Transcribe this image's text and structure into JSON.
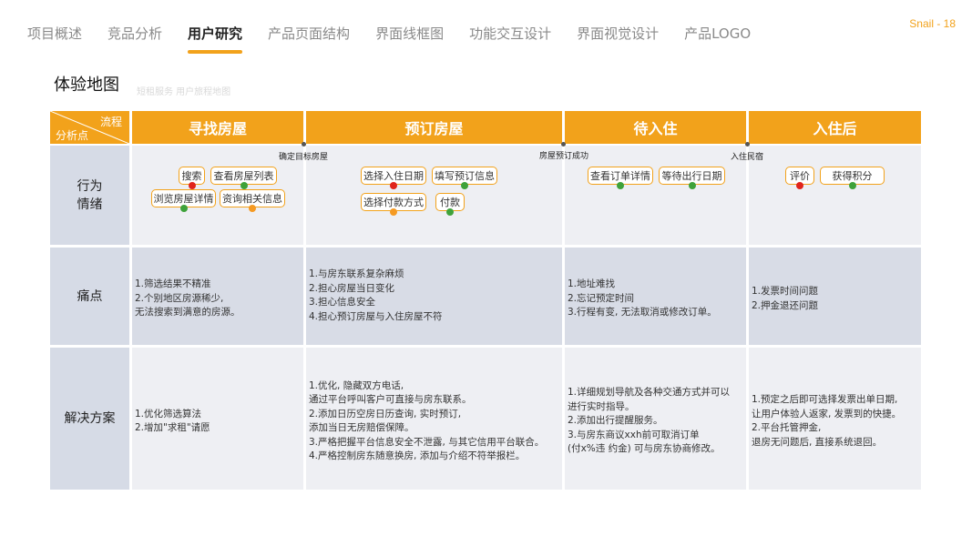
{
  "nav": {
    "items": [
      "项目概述",
      "竞品分析",
      "用户研究",
      "产品页面结构",
      "界面线框图",
      "功能交互设计",
      "界面视觉设计",
      "产品LOGO"
    ],
    "active_index": 2
  },
  "page_number": "Snail - 18",
  "section": {
    "title": "体验地图",
    "subtitle": "短租服务  用户旅程地图"
  },
  "table": {
    "corner": {
      "top": "流程",
      "bottom": "分析点"
    },
    "stages": [
      "寻找房屋",
      "预订房屋",
      "待入住",
      "入住后"
    ],
    "markers": [
      "确定目标房屋",
      "房屋预订成功",
      "入住民宿"
    ],
    "rows": {
      "behavior": {
        "label_lines": [
          "行为",
          "情绪"
        ],
        "tags": [
          [
            {
              "text": "搜索",
              "mood": "red"
            },
            {
              "text": "查看房屋列表",
              "mood": "green"
            },
            {
              "text": "浏览房屋详情",
              "mood": "green"
            },
            {
              "text": "资询相关信息",
              "mood": "orange"
            }
          ],
          [
            {
              "text": "选择入住日期",
              "mood": "red"
            },
            {
              "text": "填写预订信息",
              "mood": "green"
            },
            {
              "text": "选择付款方式",
              "mood": "orange"
            },
            {
              "text": "付款",
              "mood": "green"
            }
          ],
          [
            {
              "text": "查看订单详情",
              "mood": "green"
            },
            {
              "text": "等待出行日期",
              "mood": "green"
            }
          ],
          [
            {
              "text": "评价",
              "mood": "red"
            },
            {
              "text": "获得积分",
              "mood": "green"
            }
          ]
        ]
      },
      "pain": {
        "label": "痛点",
        "cells": [
          [
            "1.筛选结果不精准",
            "2.个别地区房源稀少,",
            "   无法搜索到满意的房源。"
          ],
          [
            "1.与房东联系复杂麻烦",
            "2.担心房屋当日变化",
            "3.担心信息安全",
            "4.担心预订房屋与入住房屋不符"
          ],
          [
            "1.地址难找",
            "2.忘记预定时间",
            "3.行程有变, 无法取消或修改订单。"
          ],
          [
            "1.发票时间问题",
            "2.押金退还问题"
          ]
        ]
      },
      "solution": {
        "label": "解决方案",
        "cells": [
          [
            "1.优化筛选算法",
            "2.增加\"求租\"请愿"
          ],
          [
            "1.优化, 隐藏双方电话,",
            "   通过平台呼叫客户可直接与房东联系。",
            "2.添加日历空房日历查询, 实时预订,",
            "   添加当日无房赔偿保障。",
            "3.严格把握平台信息安全不泄露, 与其它信用平台联合。",
            "4.严格控制房东随意换房, 添加与介绍不符举报栏。"
          ],
          [
            "1.详细规划导航及各种交通方式并可以",
            "进行实时指导。",
            "2.添加出行提醒服务。",
            "3.与房东商议xxh前可取消订单",
            "  (付x%违 约金) 可与房东协商修改。"
          ],
          [
            "1.预定之后即可选择发票出单日期,",
            "   让用户体验人返家, 发票到的快捷。",
            "2.平台托管押金,",
            "   退房无问题后, 直接系统退回。"
          ]
        ]
      }
    }
  }
}
